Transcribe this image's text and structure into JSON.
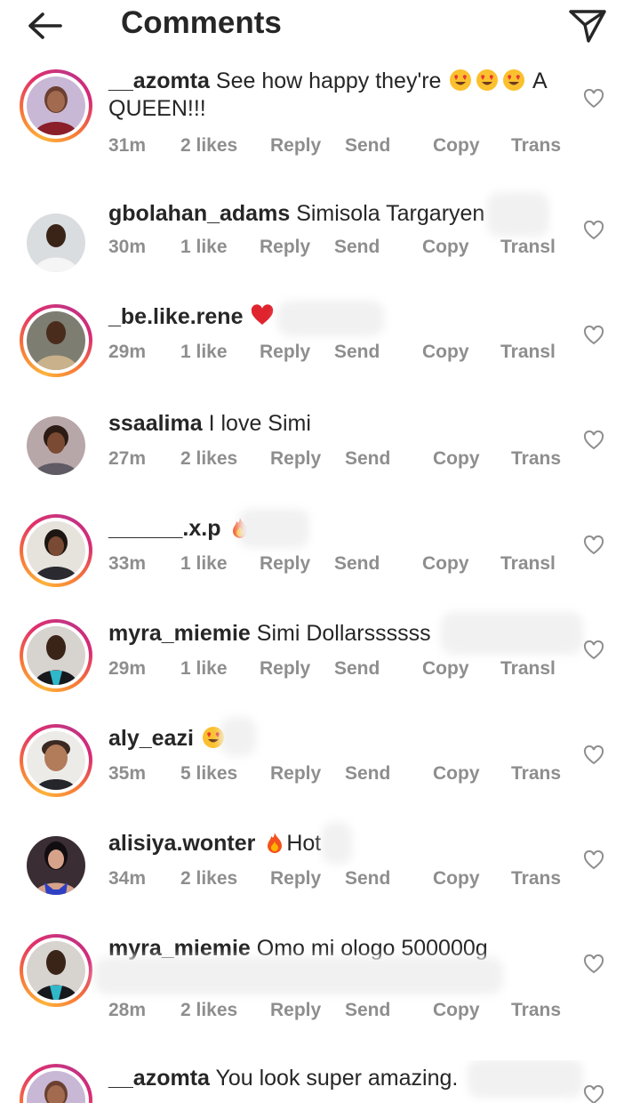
{
  "header": {
    "title": "Comments"
  },
  "icons": {
    "back": "arrow-left-icon",
    "send": "paper-plane-icon",
    "like": "heart-outline-icon",
    "emoji_love": "heart-eyes-emoji",
    "emoji_fire": "fire-emoji",
    "emoji_heart": "red-heart-emoji"
  },
  "colors": {
    "meta_text": "#8e8e8e",
    "story_ring": "#e1306c",
    "heart_emoji": "#e0242e"
  },
  "comments": [
    {
      "username": "__azomta",
      "text": "See how happy they're",
      "after_emoji": "A QUEEN!!!",
      "time": "31m",
      "likes": "2 likes",
      "reply": "Reply",
      "send": "Send",
      "copy": "Copy",
      "translate": "Trans"
    },
    {
      "username": "gbolahan_adams",
      "text": "Simisola Targaryen",
      "time": "30m",
      "likes": "1 like",
      "reply": "Reply",
      "send": "Send",
      "copy": "Copy",
      "translate": "Transl"
    },
    {
      "username": "_be.like.rene",
      "text": "",
      "time": "29m",
      "likes": "1 like",
      "reply": "Reply",
      "send": "Send",
      "copy": "Copy",
      "translate": "Transl"
    },
    {
      "username": "ssaalima",
      "text": "I love Simi",
      "time": "27m",
      "likes": "2 likes",
      "reply": "Reply",
      "send": "Send",
      "copy": "Copy",
      "translate": "Trans"
    },
    {
      "username": "______.x.p",
      "text": "",
      "time": "33m",
      "likes": "1 like",
      "reply": "Reply",
      "send": "Send",
      "copy": "Copy",
      "translate": "Transl"
    },
    {
      "username": "myra_miemie",
      "text": "Simi Dollarssssss",
      "time": "29m",
      "likes": "1 like",
      "reply": "Reply",
      "send": "Send",
      "copy": "Copy",
      "translate": "Transl"
    },
    {
      "username": "aly_eazi",
      "text": "",
      "time": "35m",
      "likes": "5 likes",
      "reply": "Reply",
      "send": "Send",
      "copy": "Copy",
      "translate": "Trans"
    },
    {
      "username": "alisiya.wonter",
      "text": "Hot",
      "time": "34m",
      "likes": "2 likes",
      "reply": "Reply",
      "send": "Send",
      "copy": "Copy",
      "translate": "Trans"
    },
    {
      "username": "myra_miemie",
      "text": "Omo mi ologo 500000g",
      "time": "28m",
      "likes": "2 likes",
      "reply": "Reply",
      "send": "Send",
      "copy": "Copy",
      "translate": "Trans"
    },
    {
      "username": "__azomta",
      "text": "You look super amazing.",
      "time": "",
      "likes": "",
      "reply": "",
      "send": "",
      "copy": "",
      "translate": ""
    }
  ]
}
